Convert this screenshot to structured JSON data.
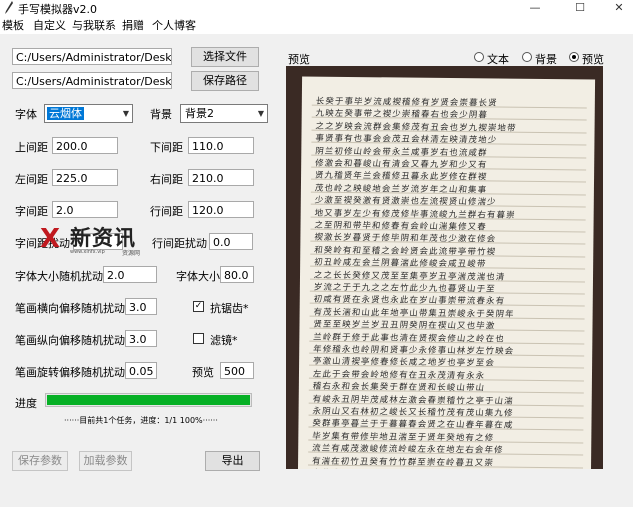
{
  "window": {
    "title": "手写模拟器v2.0",
    "controls": [
      "—",
      "☐",
      "✕"
    ]
  },
  "menu": [
    "模板",
    "自定义",
    "与我联系",
    "捐赠",
    "个人博客"
  ],
  "paths": {
    "text_file": "C:/Users/Administrator/Desktop/F",
    "save_path": "C:/Users/Administrator/Desktop"
  },
  "buttons": {
    "choose_file": "选择文件",
    "save_path": "保存路径",
    "save_params": "保存参数",
    "load_params": "加载参数",
    "export": "导出"
  },
  "fields": {
    "font_label": "字体",
    "font_value": "云烟体",
    "bg_label": "背景",
    "bg_value": "背景2",
    "top_margin_label": "上间距",
    "top_margin": "200.0",
    "bottom_margin_label": "下间距",
    "bottom_margin": "110.0",
    "left_margin_label": "左间距",
    "left_margin": "225.0",
    "right_margin_label": "右间距",
    "right_margin": "210.0",
    "char_spacing_label": "字间距",
    "char_spacing": "2.0",
    "line_spacing_label": "行间距",
    "line_spacing": "120.0",
    "char_jitter_label": "字间距扰动",
    "line_jitter_label": "行间距扰动",
    "line_jitter": "0.0",
    "size_jitter_label": "字体大小随机扰动",
    "size_jitter": "2.0",
    "font_size_label": "字体大小",
    "font_size": "80.0",
    "h_offset_label": "笔画横向偏移随机扰动",
    "h_offset": "3.0",
    "v_offset_label": "笔画纵向偏移随机扰动",
    "v_offset": "3.0",
    "rot_offset_label": "笔画旋转偏移随机扰动",
    "rot_offset": "0.05",
    "preview_label": "预览",
    "preview_value": "500"
  },
  "checks": {
    "antialias_label": "抗锯齿*",
    "antialias_mark": "✓",
    "filter_label": "滤镜*"
  },
  "radios": {
    "header": "预览",
    "text": "文本",
    "bg": "背景",
    "preview": "预览",
    "selected": "preview"
  },
  "progress": {
    "label": "进度",
    "value": 1.0,
    "status": "······目前共1个任务，进度：1/1 100%······"
  },
  "watermark": {
    "glyph": "X",
    "main": "新资讯",
    "sub1": "www.xinfx.vip",
    "sub2": "资源网"
  },
  "colors": {
    "progress": "#06b025",
    "selection": "#0078d7"
  }
}
